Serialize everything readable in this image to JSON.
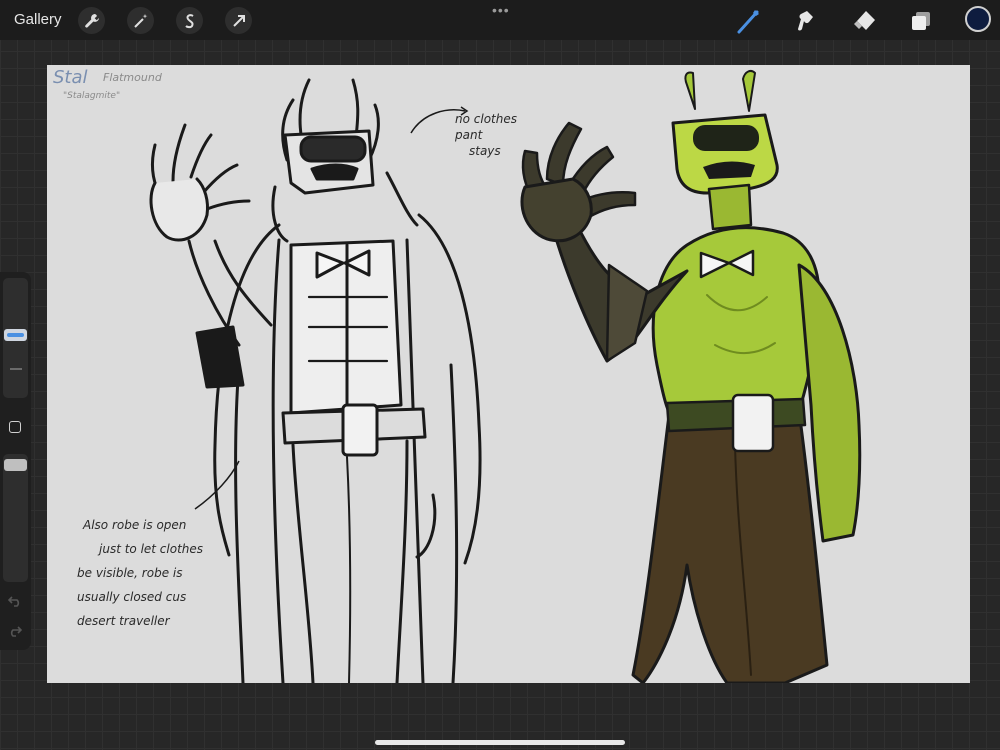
{
  "topbar": {
    "gallery_label": "Gallery",
    "left_tools": [
      "wrench-icon",
      "magic-wand-icon",
      "selection-icon",
      "transform-arrow-icon"
    ],
    "right_tools": [
      "brush-icon",
      "smudge-icon",
      "eraser-icon",
      "layers-icon"
    ],
    "more_dots": "•••",
    "active_color": "#0e1c3f",
    "active_tool_color": "#4a90e2"
  },
  "sidebar": {
    "brush_size_level": 0.2,
    "opacity_level": 0.25
  },
  "canvas": {
    "background": "#dcdcdc",
    "header_title": "Stal",
    "header_subtitle": "Flatmound",
    "header_nickname": "\"Stalagmite\"",
    "note_top": [
      "no clothes",
      "pant",
      "stays"
    ],
    "note_bottom": [
      "Also robe is open",
      "just to let clothes",
      "be visible, robe is",
      "usually closed cus",
      "desert traveller"
    ],
    "skin_color": "#a6c93a",
    "pants_color": "#4a3a22"
  }
}
